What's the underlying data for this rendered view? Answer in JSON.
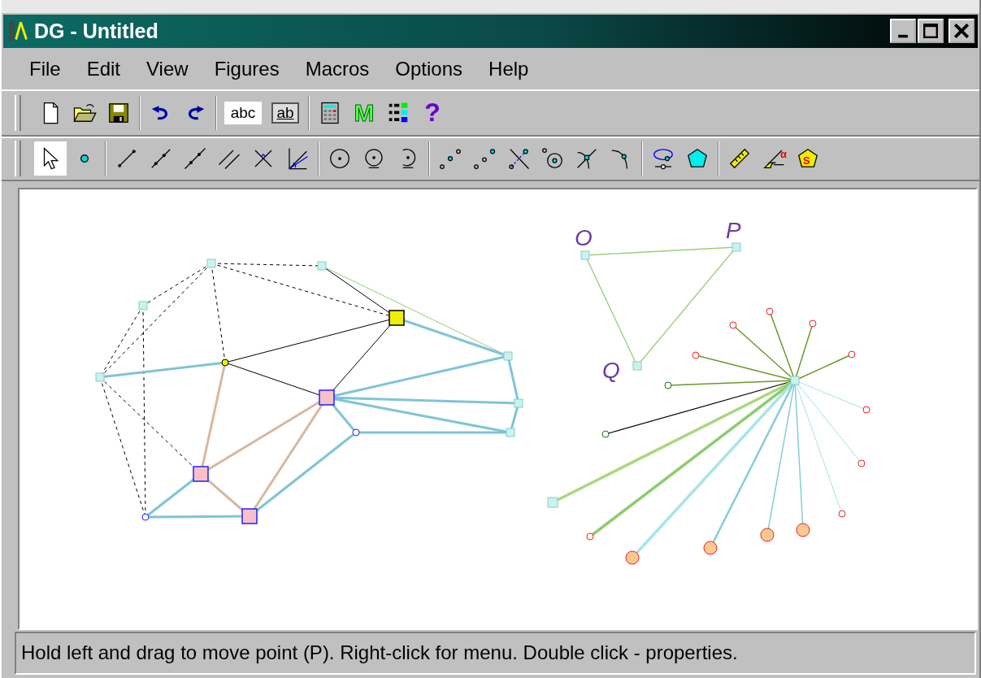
{
  "window": {
    "title": "DG - Untitled"
  },
  "menu": [
    "File",
    "Edit",
    "View",
    "Figures",
    "Macros",
    "Options",
    "Help"
  ],
  "toolbar_1": [
    [
      {
        "kind": "new"
      },
      {
        "kind": "open"
      },
      {
        "kind": "save"
      }
    ],
    [
      {
        "kind": "undo"
      },
      {
        "kind": "redo"
      }
    ],
    [
      {
        "kind": "label",
        "glyph": "abc"
      },
      {
        "kind": "field",
        "glyph": "ab"
      }
    ],
    [
      {
        "kind": "calc"
      },
      {
        "kind": "macro",
        "glyph": "M"
      },
      {
        "kind": "list"
      },
      {
        "kind": "help",
        "glyph": "?"
      }
    ]
  ],
  "toolbar_2": [
    [
      {
        "kind": "pointer",
        "selected": true
      },
      {
        "kind": "point",
        "selected": false
      }
    ],
    [
      {
        "kind": "segment",
        "selected": false
      },
      {
        "kind": "ray",
        "selected": false
      },
      {
        "kind": "line",
        "selected": false
      },
      {
        "kind": "parallel",
        "selected": false
      },
      {
        "kind": "perpendicular",
        "selected": false
      },
      {
        "kind": "bisector",
        "selected": false
      }
    ],
    [
      {
        "kind": "circle",
        "selected": false
      },
      {
        "kind": "circle2",
        "selected": false
      },
      {
        "kind": "arc",
        "selected": false
      }
    ],
    [
      {
        "kind": "midpoint",
        "selected": false
      },
      {
        "kind": "ratio",
        "selected": false
      },
      {
        "kind": "reflect",
        "selected": false
      },
      {
        "kind": "inversion",
        "selected": false
      },
      {
        "kind": "intersect",
        "selected": false
      },
      {
        "kind": "oncurve",
        "selected": false
      }
    ],
    [
      {
        "kind": "locus",
        "selected": false
      },
      {
        "kind": "polygon",
        "selected": false
      }
    ],
    [
      {
        "kind": "ruler",
        "selected": false
      },
      {
        "kind": "angle",
        "glyph": "α",
        "selected": false
      },
      {
        "kind": "area",
        "glyph": "S",
        "selected": false
      }
    ]
  ],
  "canvas": {
    "labels": [
      "O",
      "P",
      "Q"
    ]
  },
  "status_bar": "Hold left and drag to move point (P). Right-click for menu. Double click - properties."
}
